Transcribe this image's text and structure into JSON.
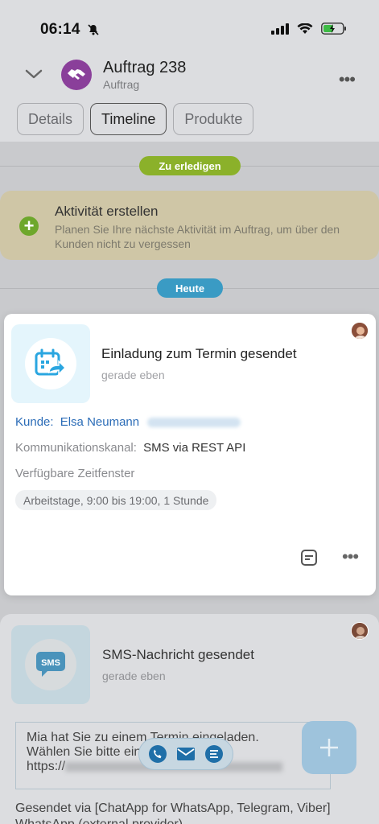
{
  "status_bar": {
    "time": "06:14"
  },
  "header": {
    "title": "Auftrag 238",
    "subtitle": "Auftrag",
    "more_label": "•••"
  },
  "tabs": [
    {
      "label": "Details",
      "active": false
    },
    {
      "label": "Timeline",
      "active": true
    },
    {
      "label": "Produkte",
      "active": false
    }
  ],
  "timeline": {
    "todo_pill": "Zu erledigen",
    "today_pill": "Heute",
    "create_activity": {
      "title": "Aktivität erstellen",
      "description": "Planen Sie Ihre nächste Aktivität im Auftrag, um über den Kunden nicht zu vergessen"
    }
  },
  "invite_card": {
    "title": "Einladung zum Termin gesendet",
    "time": "gerade eben",
    "customer_label": "Kunde:",
    "customer_name": "Elsa Neumann",
    "channel_label": "Kommunikationskanal:",
    "channel_value": "SMS via REST API",
    "slots_label": "Verfügbare Zeitfenster",
    "slot_chip": "Arbeitstage, 9:00 bis 19:00, 1 Stunde"
  },
  "sms_card": {
    "title": "SMS-Nachricht gesendet",
    "time": "gerade eben",
    "icon_text": "SMS",
    "body_line1": "Mia hat Sie zu einem Termin eingeladen.",
    "body_line2": "Wählen Sie bitte einen Termin aus:",
    "body_line3": "https://",
    "sent_via": "Gesendet via [ChatApp for WhatsApp, Telegram, Viber] WhatsApp (external provider)"
  },
  "colors": {
    "accent_blue": "#2b6cb7",
    "todo_green": "#8bb12a",
    "today_blue": "#3a9bc4",
    "deal_purple": "#8a3f9a"
  }
}
